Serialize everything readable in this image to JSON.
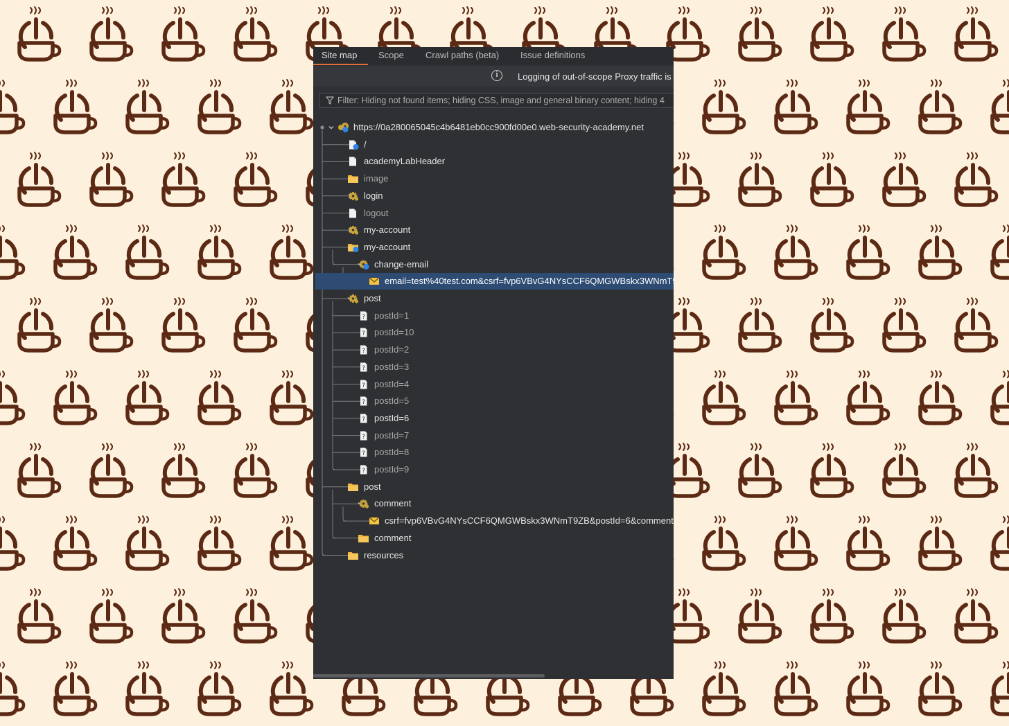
{
  "tabs": [
    {
      "label": "Site map",
      "active": true
    },
    {
      "label": "Scope",
      "active": false
    },
    {
      "label": "Crawl paths (beta)",
      "active": false
    },
    {
      "label": "Issue definitions",
      "active": false
    }
  ],
  "banner": {
    "message": "Logging of out-of-scope Proxy traffic is"
  },
  "filter": {
    "text": "Filter: Hiding not found items; hiding CSS, image and general binary content; hiding 4"
  },
  "colors": {
    "background": "#fdf0dc",
    "pattern": "#5c2a14",
    "panel": "#2f3033",
    "selection": "#2e4b73",
    "active_tab_underline": "#e06f3a",
    "folder": "#f3b642",
    "gear": "#c9a43a",
    "envelope": "#f2c240",
    "badge": "#2f86e8"
  },
  "tree": [
    {
      "label": "https://0a280065045c4b6481eb0cc900fd00e0.web-security-academy.net",
      "depth": 0,
      "icon": "site-icon",
      "expander": "expanded",
      "style": "bright"
    },
    {
      "label": "/",
      "depth": 1,
      "icon": "page-badge-icon",
      "expander": "none",
      "style": "bright"
    },
    {
      "label": "academyLabHeader",
      "depth": 1,
      "icon": "page-icon",
      "expander": "none",
      "style": "bright"
    },
    {
      "label": "image",
      "depth": 1,
      "icon": "folder-icon",
      "expander": "collapsed",
      "style": "dim"
    },
    {
      "label": "login",
      "depth": 1,
      "icon": "gear-icon",
      "expander": "collapsed",
      "style": "bright"
    },
    {
      "label": "logout",
      "depth": 1,
      "icon": "page-icon",
      "expander": "none",
      "style": "dim"
    },
    {
      "label": "my-account",
      "depth": 1,
      "icon": "gear-icon",
      "expander": "collapsed",
      "style": "bright"
    },
    {
      "label": "my-account",
      "depth": 1,
      "icon": "folder-badge-icon",
      "expander": "expanded",
      "style": "bright"
    },
    {
      "label": "change-email",
      "depth": 2,
      "icon": "gear-badge-icon",
      "expander": "expanded",
      "style": "bright"
    },
    {
      "label": "email=test%40test.com&csrf=fvp6VBvG4NYsCCF6QMGWBskx3WNmT9",
      "depth": 3,
      "icon": "envelope-icon",
      "expander": "none",
      "style": "selected"
    },
    {
      "label": "post",
      "depth": 1,
      "icon": "gear-icon",
      "expander": "expanded",
      "style": "bright"
    },
    {
      "label": "postId=1",
      "depth": 2,
      "icon": "unknown-page-icon",
      "expander": "none",
      "style": "dim"
    },
    {
      "label": "postId=10",
      "depth": 2,
      "icon": "unknown-page-icon",
      "expander": "none",
      "style": "dim"
    },
    {
      "label": "postId=2",
      "depth": 2,
      "icon": "unknown-page-icon",
      "expander": "none",
      "style": "dim"
    },
    {
      "label": "postId=3",
      "depth": 2,
      "icon": "unknown-page-icon",
      "expander": "none",
      "style": "dim"
    },
    {
      "label": "postId=4",
      "depth": 2,
      "icon": "unknown-page-icon",
      "expander": "none",
      "style": "dim"
    },
    {
      "label": "postId=5",
      "depth": 2,
      "icon": "unknown-page-icon",
      "expander": "none",
      "style": "dim"
    },
    {
      "label": "postId=6",
      "depth": 2,
      "icon": "unknown-page-icon",
      "expander": "none",
      "style": "bright"
    },
    {
      "label": "postId=7",
      "depth": 2,
      "icon": "unknown-page-icon",
      "expander": "none",
      "style": "dim"
    },
    {
      "label": "postId=8",
      "depth": 2,
      "icon": "unknown-page-icon",
      "expander": "none",
      "style": "dim"
    },
    {
      "label": "postId=9",
      "depth": 2,
      "icon": "unknown-page-icon",
      "expander": "none",
      "style": "dim"
    },
    {
      "label": "post",
      "depth": 1,
      "icon": "folder-icon",
      "expander": "expanded",
      "style": "bright"
    },
    {
      "label": "comment",
      "depth": 2,
      "icon": "gear-icon",
      "expander": "expanded",
      "style": "bright"
    },
    {
      "label": "csrf=fvp6VBvG4NYsCCF6QMGWBskx3WNmT9ZB&postId=6&comment=",
      "depth": 3,
      "icon": "envelope-icon",
      "expander": "none",
      "style": "bright"
    },
    {
      "label": "comment",
      "depth": 2,
      "icon": "folder-icon",
      "expander": "collapsed",
      "style": "bright"
    },
    {
      "label": "resources",
      "depth": 1,
      "icon": "folder-icon",
      "expander": "collapsed",
      "style": "bright"
    }
  ]
}
